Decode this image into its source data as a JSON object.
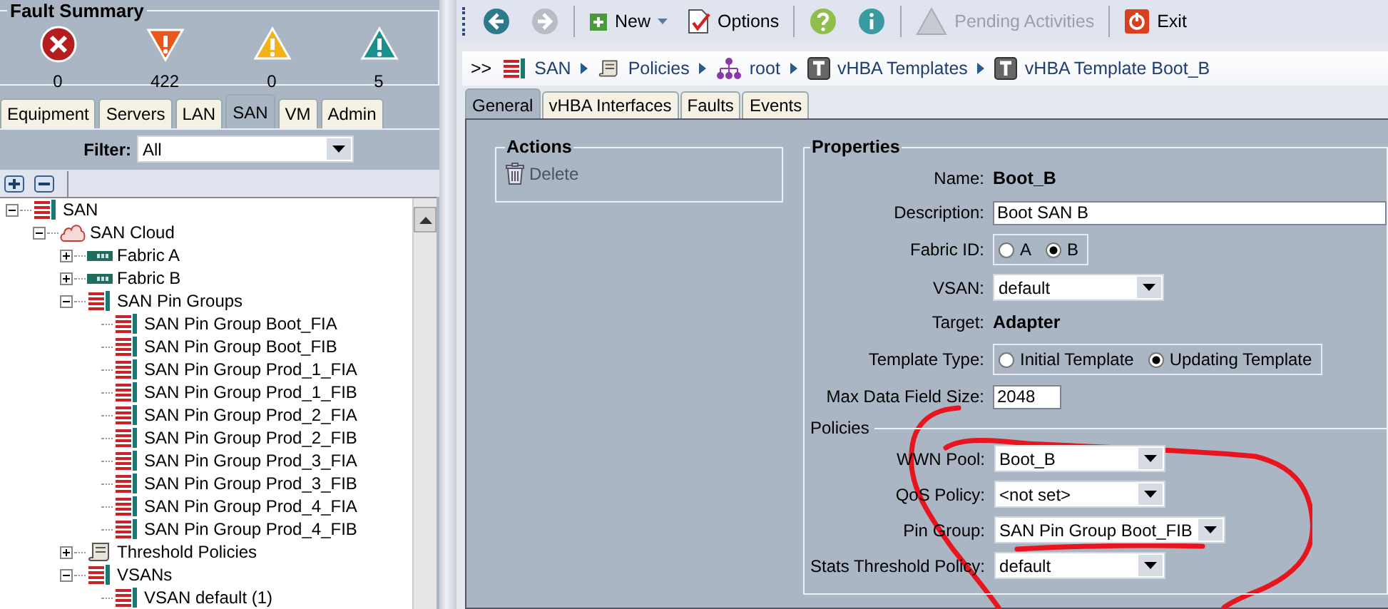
{
  "fault_summary": {
    "title": "Fault Summary",
    "items": [
      {
        "kind": "critical",
        "count": "0"
      },
      {
        "kind": "major",
        "count": "422"
      },
      {
        "kind": "minor",
        "count": "0"
      },
      {
        "kind": "warning",
        "count": "5"
      }
    ]
  },
  "nav_tabs": [
    {
      "label": "Equipment",
      "selected": false
    },
    {
      "label": "Servers",
      "selected": false
    },
    {
      "label": "LAN",
      "selected": false
    },
    {
      "label": "SAN",
      "selected": true
    },
    {
      "label": "VM",
      "selected": false
    },
    {
      "label": "Admin",
      "selected": false
    }
  ],
  "filter": {
    "label": "Filter:",
    "value": "All"
  },
  "tree": [
    {
      "label": "SAN",
      "kind": "bars",
      "expanded": true,
      "children": [
        {
          "label": "SAN Cloud",
          "kind": "cloud",
          "expanded": true,
          "children": [
            {
              "label": "Fabric A",
              "kind": "fabric",
              "expanded": false
            },
            {
              "label": "Fabric B",
              "kind": "fabric",
              "expanded": false
            },
            {
              "label": "SAN Pin Groups",
              "kind": "bars",
              "expanded": true,
              "children": [
                {
                  "label": "SAN Pin Group Boot_FIA",
                  "kind": "bars"
                },
                {
                  "label": "SAN Pin Group Boot_FIB",
                  "kind": "bars"
                },
                {
                  "label": "SAN Pin Group Prod_1_FIA",
                  "kind": "bars"
                },
                {
                  "label": "SAN Pin Group Prod_1_FIB",
                  "kind": "bars"
                },
                {
                  "label": "SAN Pin Group Prod_2_FIA",
                  "kind": "bars"
                },
                {
                  "label": "SAN Pin Group Prod_2_FIB",
                  "kind": "bars"
                },
                {
                  "label": "SAN Pin Group Prod_3_FIA",
                  "kind": "bars"
                },
                {
                  "label": "SAN Pin Group Prod_3_FIB",
                  "kind": "bars"
                },
                {
                  "label": "SAN Pin Group Prod_4_FIA",
                  "kind": "bars"
                },
                {
                  "label": "SAN Pin Group Prod_4_FIB",
                  "kind": "bars"
                }
              ]
            },
            {
              "label": "Threshold Policies",
              "kind": "scroll",
              "expanded": false
            },
            {
              "label": "VSANs",
              "kind": "bars",
              "expanded": true,
              "children": [
                {
                  "label": "VSAN default (1)",
                  "kind": "bars"
                }
              ]
            }
          ]
        }
      ]
    }
  ],
  "toolbar": [
    {
      "kind": "back",
      "disabled": false
    },
    {
      "kind": "forward",
      "disabled": true
    },
    {
      "kind": "new",
      "label": "New",
      "disabled": false
    },
    {
      "kind": "options",
      "label": "Options",
      "disabled": false
    },
    {
      "kind": "help",
      "disabled": false
    },
    {
      "kind": "info",
      "disabled": false
    },
    {
      "kind": "pending",
      "label": "Pending Activities",
      "disabled": true
    },
    {
      "kind": "exit",
      "label": "Exit",
      "disabled": false
    }
  ],
  "breadcrumb": {
    "prefix": ">>",
    "items": [
      {
        "label": "SAN",
        "kind": "bars"
      },
      {
        "label": "Policies",
        "kind": "scroll"
      },
      {
        "label": "root",
        "kind": "org"
      },
      {
        "label": "vHBA Templates",
        "kind": "template"
      },
      {
        "label": "vHBA Template Boot_B",
        "kind": "template"
      }
    ]
  },
  "content_tabs": [
    {
      "label": "General",
      "selected": true
    },
    {
      "label": "vHBA Interfaces",
      "selected": false
    },
    {
      "label": "Faults",
      "selected": false
    },
    {
      "label": "Events",
      "selected": false
    }
  ],
  "actions": {
    "title": "Actions",
    "items": [
      {
        "label": "Delete"
      }
    ]
  },
  "properties": {
    "title": "Properties",
    "fields": [
      {
        "label": "Name:",
        "kind": "value",
        "value": "Boot_B"
      },
      {
        "label": "Description:",
        "kind": "input",
        "value": "Boot SAN B"
      },
      {
        "label": "Fabric ID:",
        "kind": "radio",
        "options": [
          {
            "label": "A",
            "selected": false
          },
          {
            "label": "B",
            "selected": true
          }
        ]
      },
      {
        "label": "VSAN:",
        "kind": "select",
        "value": "default"
      },
      {
        "label": "Target:",
        "kind": "value",
        "value": "Adapter"
      },
      {
        "label": "Template Type:",
        "kind": "radio",
        "options": [
          {
            "label": "Initial Template",
            "selected": false
          },
          {
            "label": "Updating Template",
            "selected": true
          }
        ]
      },
      {
        "label": "Max Data Field Size:",
        "kind": "input",
        "value": "2048"
      }
    ],
    "policies": {
      "title": "Policies",
      "fields": [
        {
          "label": "WWN Pool:",
          "kind": "select",
          "value": "Boot_B"
        },
        {
          "label": "QoS Policy:",
          "kind": "select",
          "value": "<not set>"
        },
        {
          "label": "Pin Group:",
          "kind": "select",
          "value": "SAN Pin Group Boot_FIB"
        },
        {
          "label": "Stats Threshold Policy:",
          "kind": "select",
          "value": "default"
        }
      ]
    }
  }
}
